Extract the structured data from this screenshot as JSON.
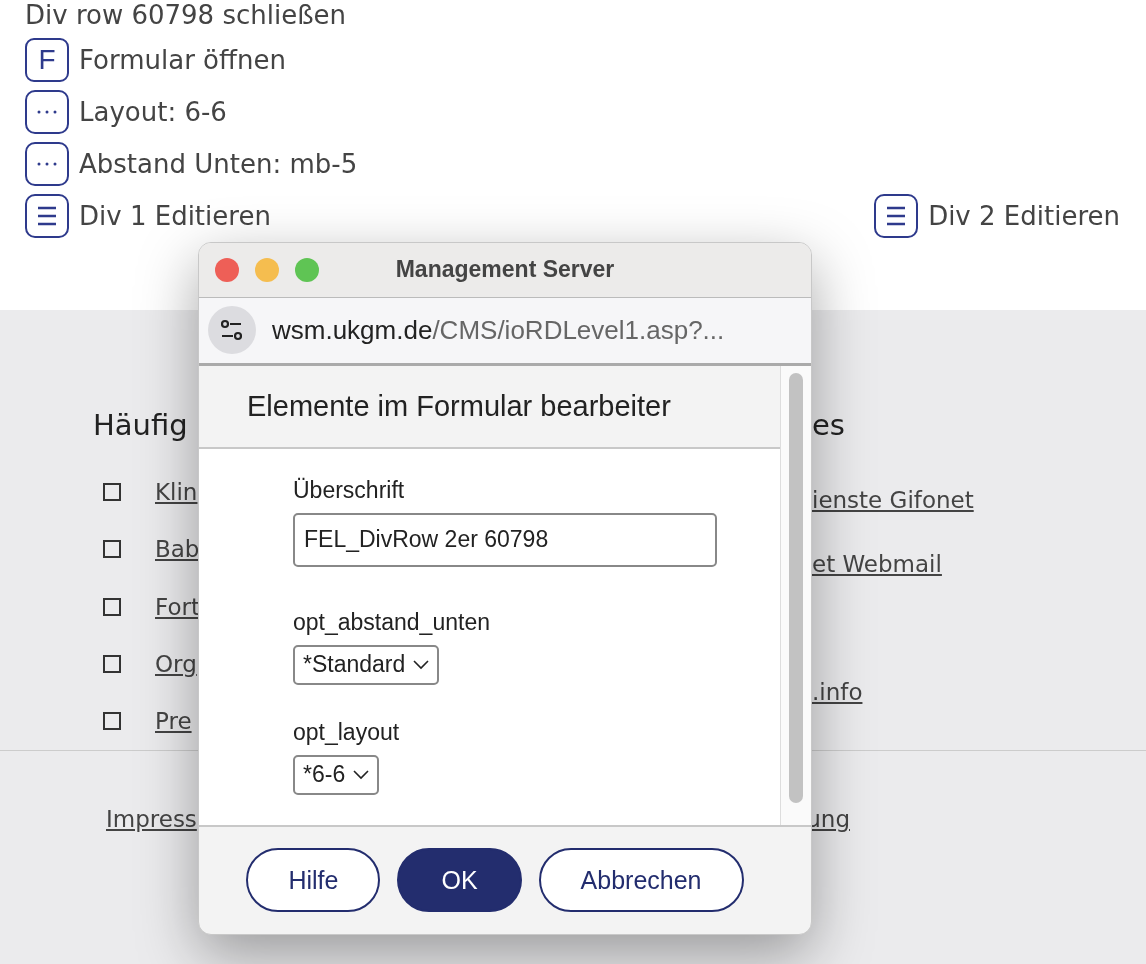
{
  "editor": {
    "close_link": "Div row 60798 schließen",
    "actions": [
      {
        "kind": "letter",
        "icon_text": "F",
        "label": "Formular öffnen"
      },
      {
        "kind": "dots",
        "label": "Layout: 6-6"
      },
      {
        "kind": "dots",
        "label": "Abstand Unten: mb-5"
      }
    ],
    "div_edits": [
      {
        "label": "Div 1 Editieren"
      },
      {
        "label": "Div 2 Editieren"
      }
    ]
  },
  "links_section": {
    "columns": [
      {
        "heading": "Häufig",
        "bullets": true,
        "links": [
          {
            "label": "Klin",
            "gap_before": false
          },
          {
            "label": "Bab",
            "gap_before": false
          },
          {
            "label": "Fort",
            "gap_before": false
          },
          {
            "label": "Org",
            "gap_before": false
          },
          {
            "label": "Pre",
            "gap_before": false
          }
        ]
      },
      {
        "heading": "es",
        "bullets": false,
        "links": [
          {
            "label": "ienste Gifonet",
            "gap_before": false
          },
          {
            "label": "et Webmail",
            "gap_before": false
          },
          {
            "label": ".info",
            "gap_before": true
          }
        ]
      }
    ]
  },
  "footer": {
    "links": [
      "Impress",
      "ung"
    ]
  },
  "dialog": {
    "title": "Management Server",
    "url_host": "wsm.ukgm.de",
    "url_path": "/CMS/ioRDLevel1.asp?...",
    "heading": "Elemente im Formular bearbeiter",
    "fields": [
      {
        "kind": "text",
        "label": "Überschrift",
        "value": "FEL_DivRow 2er 60798"
      },
      {
        "kind": "select",
        "label": "opt_abstand_unten",
        "value": "*Standard"
      },
      {
        "kind": "select",
        "label": "opt_layout",
        "value": "*6-6"
      }
    ],
    "buttons": [
      {
        "label": "Hilfe",
        "primary": false
      },
      {
        "label": "OK",
        "primary": true
      },
      {
        "label": "Abbrechen",
        "primary": false
      }
    ]
  }
}
